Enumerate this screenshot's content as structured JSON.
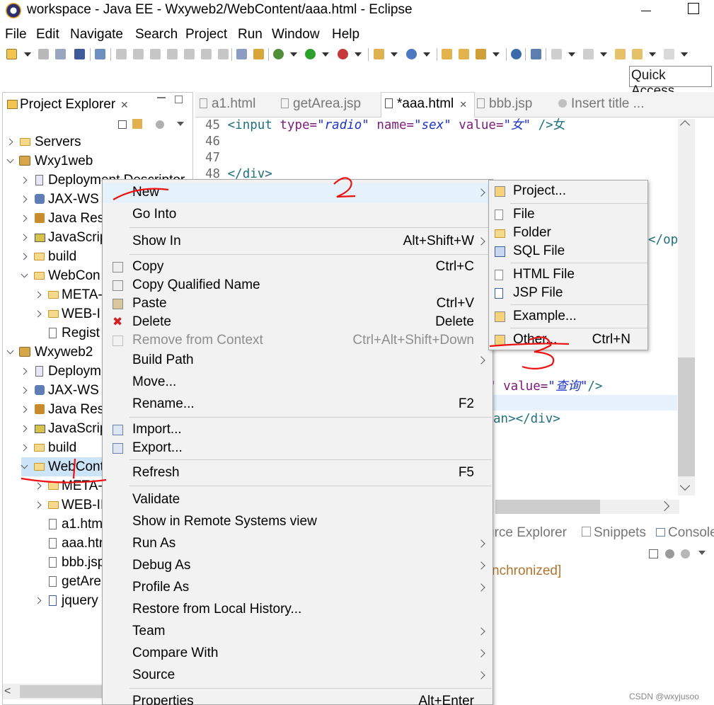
{
  "window": {
    "title": "workspace - Java EE - Wxyweb2/WebContent/aaa.html - Eclipse"
  },
  "menubar": [
    "File",
    "Edit",
    "Navigate",
    "Search",
    "Project",
    "Run",
    "Window",
    "Help"
  ],
  "quick_access": "Quick Access",
  "project_explorer": {
    "tab_label": "Project Explorer",
    "tree": [
      {
        "label": "Servers"
      },
      {
        "label": "Wxy1web"
      },
      {
        "label": "Deployment Descriptor"
      },
      {
        "label": "JAX-WS W"
      },
      {
        "label": "Java Reso"
      },
      {
        "label": "JavaScrip"
      },
      {
        "label": "build"
      },
      {
        "label": "WebCon"
      },
      {
        "label": "META-"
      },
      {
        "label": "WEB-I"
      },
      {
        "label": "Regist"
      },
      {
        "label": "Wxyweb2"
      },
      {
        "label": "Deploym"
      },
      {
        "label": "JAX-WS W"
      },
      {
        "label": "Java Reso"
      },
      {
        "label": "JavaScrip"
      },
      {
        "label": "build"
      },
      {
        "label": "WebCont"
      },
      {
        "label": "META-"
      },
      {
        "label": "WEB-II"
      },
      {
        "label": "a1.htm"
      },
      {
        "label": "aaa.htr"
      },
      {
        "label": "bbb.jsp"
      },
      {
        "label": "getAre"
      },
      {
        "label": "jquery"
      }
    ]
  },
  "editor": {
    "tabs": [
      "a1.html",
      "getArea.jsp",
      "*aaa.html",
      "bbb.jsp",
      "Insert title ..."
    ],
    "lines": [
      {
        "num": "45",
        "tag_open": "<input",
        "a1": " type=",
        "v1": "\"radio\"",
        "a2": " name=",
        "v2": "\"sex\"",
        "a3": " value=",
        "v3": "\"女\"",
        "tail": " />女"
      },
      {
        "num": "46"
      },
      {
        "num": "47"
      },
      {
        "num": "48",
        "text": "</div>"
      }
    ],
    "fragments": {
      "opt": "</opt",
      "query_attr": "\" value=",
      "query_val": "\"查询\"",
      "query_tail": "/>",
      "span_div": "an></div>"
    }
  },
  "bottom_panel": {
    "tabs": [
      "urce Explorer",
      "Snippets",
      "Console"
    ],
    "status": "nchronized]"
  },
  "context_menu": {
    "items": [
      {
        "label": "New",
        "shortcut": "",
        "submenu": true
      },
      {
        "label": "Go Into",
        "shortcut": ""
      },
      {
        "label": "Show In",
        "shortcut": "Alt+Shift+W",
        "submenu": true
      },
      {
        "label": "Copy",
        "shortcut": "Ctrl+C"
      },
      {
        "label": "Copy Qualified Name",
        "shortcut": ""
      },
      {
        "label": "Paste",
        "shortcut": "Ctrl+V"
      },
      {
        "label": "Delete",
        "shortcut": "Delete"
      },
      {
        "label": "Remove from Context",
        "shortcut": "Ctrl+Alt+Shift+Down",
        "disabled": true
      },
      {
        "label": "Build Path",
        "shortcut": "",
        "submenu": true
      },
      {
        "label": "Move...",
        "shortcut": ""
      },
      {
        "label": "Rename...",
        "shortcut": "F2"
      },
      {
        "label": "Import...",
        "shortcut": ""
      },
      {
        "label": "Export...",
        "shortcut": ""
      },
      {
        "label": "Refresh",
        "shortcut": "F5"
      },
      {
        "label": "Validate",
        "shortcut": ""
      },
      {
        "label": "Show in Remote Systems view",
        "shortcut": ""
      },
      {
        "label": "Run As",
        "shortcut": "",
        "submenu": true
      },
      {
        "label": "Debug As",
        "shortcut": "",
        "submenu": true
      },
      {
        "label": "Profile As",
        "shortcut": "",
        "submenu": true
      },
      {
        "label": "Restore from Local History...",
        "shortcut": ""
      },
      {
        "label": "Team",
        "shortcut": "",
        "submenu": true
      },
      {
        "label": "Compare With",
        "shortcut": "",
        "submenu": true
      },
      {
        "label": "Source",
        "shortcut": "",
        "submenu": true
      },
      {
        "label": "Properties",
        "shortcut": "Alt+Enter"
      }
    ]
  },
  "new_submenu": {
    "items": [
      {
        "label": "Project...",
        "shortcut": ""
      },
      {
        "label": "File",
        "shortcut": ""
      },
      {
        "label": "Folder",
        "shortcut": ""
      },
      {
        "label": "SQL File",
        "shortcut": ""
      },
      {
        "label": "HTML File",
        "shortcut": ""
      },
      {
        "label": "JSP File",
        "shortcut": ""
      },
      {
        "label": "Example...",
        "shortcut": ""
      },
      {
        "label": "Other...",
        "shortcut": "Ctrl+N"
      }
    ]
  },
  "annotations": {
    "step1": "1",
    "step2": "2",
    "step3": "3",
    "color": "#ee1111"
  },
  "watermark": "CSDN @wxyjusoo"
}
